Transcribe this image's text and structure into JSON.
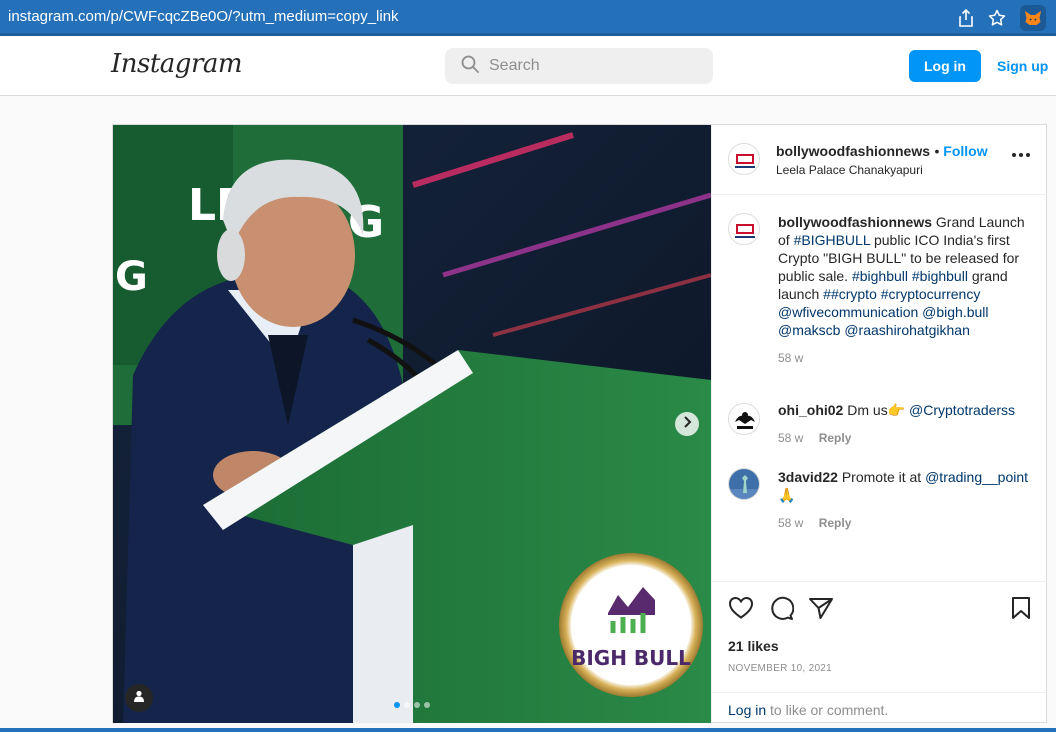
{
  "browser": {
    "url": "instagram.com/p/CWFcqcZBe0O/?utm_medium=copy_link",
    "icons": [
      "share-icon",
      "star-icon",
      "metamask-fox-icon"
    ]
  },
  "header": {
    "logo": "Instagram",
    "search_placeholder": "Search",
    "login_label": "Log in",
    "signup_label": "Sign up"
  },
  "media": {
    "sign_top_text": "LE",
    "sign_right_text": "G",
    "sign_left_text": "G",
    "podium_logo_text": "BIGH BULL",
    "carousel_dots": 4,
    "active_dot": 0
  },
  "post": {
    "author": "bollywoodfashionnews",
    "follow_label": "Follow",
    "location": "Leela Palace Chanakyapuri",
    "caption": {
      "author": "bollywoodfashionnews",
      "text1": "Grand Launch of",
      "tag1": "#BIGHBULL",
      "text2": "public ICO India's first Crypto \"BIGH BULL\" to be released for public sale.",
      "tags": [
        "#bighbull",
        "#bighbull"
      ],
      "text3": "grand launch",
      "tags2": [
        "##crypto",
        "#cryptocurrency"
      ],
      "mentions": [
        "@wfivecommunication",
        "@bigh.bull",
        "@makscb",
        "@raashirohatgikhan"
      ],
      "time": "58 w"
    },
    "comments": [
      {
        "user": "ohi_ohi02",
        "text": "Dm us👉",
        "mention": "@Cryptotraderss",
        "time": "58 w",
        "reply": "Reply"
      },
      {
        "user": "3david22",
        "text": "Promote it at",
        "mention": "@trading__point",
        "emoji": "🙏",
        "time": "58 w",
        "reply": "Reply"
      }
    ],
    "likes": "21 likes",
    "date": "NOVEMBER 10, 2021",
    "login_link": "Log in",
    "login_suffix": "to like or comment."
  },
  "colors": {
    "browser_bar": "#2471b9",
    "accent": "#0095f6",
    "tag": "#00376b",
    "stage_green": "#1f7a3e"
  }
}
